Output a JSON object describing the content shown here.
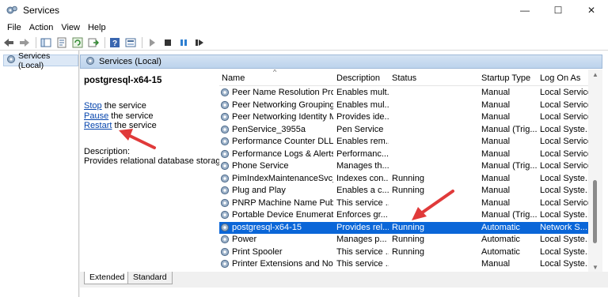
{
  "window": {
    "title": "Services",
    "minimize": "—",
    "maximize": "☐",
    "close": "✕"
  },
  "menu": [
    "File",
    "Action",
    "View",
    "Help"
  ],
  "toolbar_icons": [
    "back-icon",
    "forward-icon",
    "console-tree-icon",
    "properties-icon",
    "refresh-icon",
    "export-icon",
    "help-icon",
    "view-icon",
    "start-icon",
    "stop-icon",
    "pause-icon",
    "restart-icon"
  ],
  "tree": {
    "item": "Services (Local)"
  },
  "main_header": "Services (Local)",
  "detail": {
    "service_name": "postgresql-x64-15",
    "stop_link": "Stop",
    "stop_rest": " the service",
    "pause_link": "Pause",
    "pause_rest": " the service",
    "restart_link": "Restart",
    "restart_rest": " the service",
    "description_label": "Description:",
    "description_text": "Provides relational database storage."
  },
  "columns": {
    "name": "Name",
    "description": "Description",
    "status": "Status",
    "startup": "Startup Type",
    "logon": "Log On As",
    "sort": "^"
  },
  "rows": [
    {
      "name": "Peer Name Resolution Prot...",
      "desc": "Enables mult...",
      "status": "",
      "startup": "Manual",
      "logon": "Local Service"
    },
    {
      "name": "Peer Networking Grouping",
      "desc": "Enables mul...",
      "status": "",
      "startup": "Manual",
      "logon": "Local Service"
    },
    {
      "name": "Peer Networking Identity M...",
      "desc": "Provides ide...",
      "status": "",
      "startup": "Manual",
      "logon": "Local Service"
    },
    {
      "name": "PenService_3955a",
      "desc": "Pen Service",
      "status": "",
      "startup": "Manual (Trig...",
      "logon": "Local Syste..."
    },
    {
      "name": "Performance Counter DLL ...",
      "desc": "Enables rem...",
      "status": "",
      "startup": "Manual",
      "logon": "Local Service"
    },
    {
      "name": "Performance Logs & Alerts",
      "desc": "Performanc...",
      "status": "",
      "startup": "Manual",
      "logon": "Local Service"
    },
    {
      "name": "Phone Service",
      "desc": "Manages th...",
      "status": "",
      "startup": "Manual (Trig...",
      "logon": "Local Service"
    },
    {
      "name": "PimIndexMaintenanceSvc_...",
      "desc": "Indexes con...",
      "status": "Running",
      "startup": "Manual",
      "logon": "Local Syste..."
    },
    {
      "name": "Plug and Play",
      "desc": "Enables a c...",
      "status": "Running",
      "startup": "Manual",
      "logon": "Local Syste..."
    },
    {
      "name": "PNRP Machine Name Publi...",
      "desc": "This service ...",
      "status": "",
      "startup": "Manual",
      "logon": "Local Service"
    },
    {
      "name": "Portable Device Enumerator...",
      "desc": "Enforces gr...",
      "status": "",
      "startup": "Manual (Trig...",
      "logon": "Local Syste..."
    },
    {
      "name": "postgresql-x64-15",
      "desc": "Provides rel...",
      "status": "Running",
      "startup": "Automatic",
      "logon": "Network S..."
    },
    {
      "name": "Power",
      "desc": "Manages p...",
      "status": "Running",
      "startup": "Automatic",
      "logon": "Local Syste..."
    },
    {
      "name": "Print Spooler",
      "desc": "This service ...",
      "status": "Running",
      "startup": "Automatic",
      "logon": "Local Syste..."
    },
    {
      "name": "Printer Extensions and Notif...",
      "desc": "This service ...",
      "status": "",
      "startup": "Manual",
      "logon": "Local Syste..."
    }
  ],
  "selected_row_index": 11,
  "tabs": {
    "extended": "Extended",
    "standard": "Standard"
  },
  "colors": {
    "selection": "#0a66d8",
    "annotation_arrow": "#e03a3a",
    "link": "#0645ad"
  }
}
